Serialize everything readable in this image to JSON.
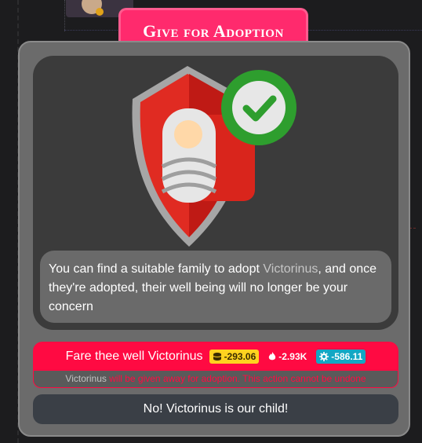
{
  "dialog": {
    "title": "Give for Adoption",
    "description_before": "You can find a suitable family to adopt ",
    "child_name": "Victorinus",
    "description_after": ", and once they're adopted, their well being will no longer be your concern",
    "emblem_icon": "shield-baby-check-icon"
  },
  "confirm": {
    "label": "Fare thee well Victorinus",
    "costs": [
      {
        "icon": "coins-icon",
        "value": "-293.06",
        "color": "#ffd21f"
      },
      {
        "icon": "flame-icon",
        "value": "-2.93K",
        "color": "#ffffff"
      },
      {
        "icon": "gear-icon",
        "value": "-586.11",
        "color": "#13a7c4"
      }
    ]
  },
  "warning": {
    "name": "Victorinus",
    "text": " will be given away for adoption. This action cannot be undone"
  },
  "cancel": {
    "label": "No! Victorinus is our child!"
  }
}
